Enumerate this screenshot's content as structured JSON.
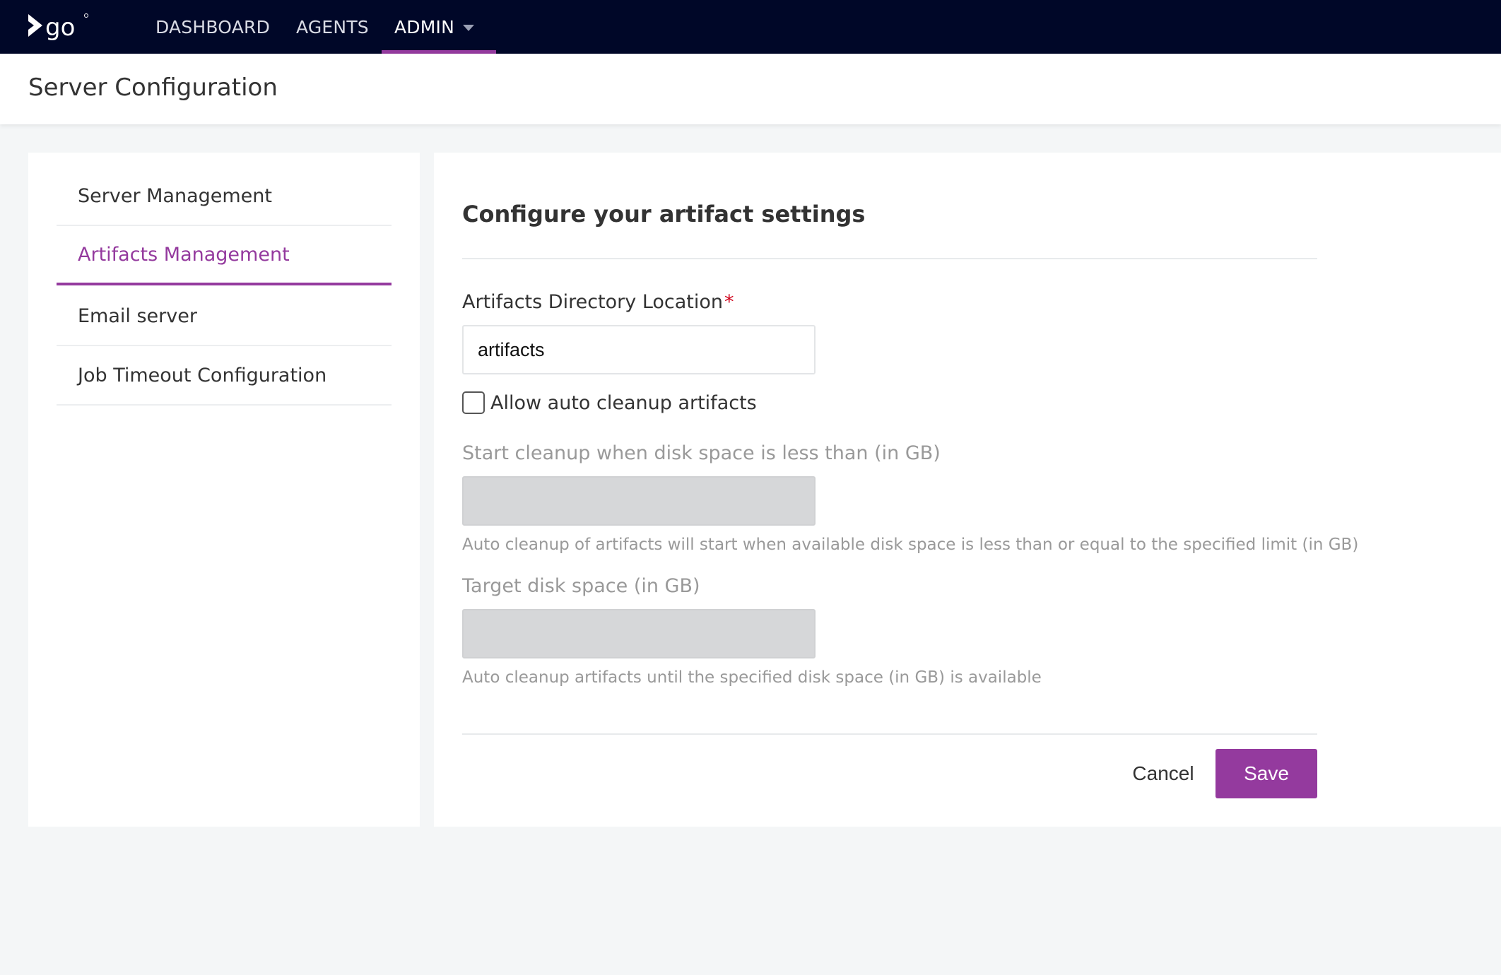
{
  "brand": {
    "logo_text": "go",
    "accent_color": "#943a9e",
    "nav_bg": "#000728"
  },
  "topnav": {
    "items": [
      {
        "label": "DASHBOARD"
      },
      {
        "label": "AGENTS"
      },
      {
        "label": "ADMIN",
        "active": true,
        "has_dropdown": true
      }
    ]
  },
  "page": {
    "title": "Server Configuration"
  },
  "sidebar": {
    "items": [
      {
        "label": "Server Management"
      },
      {
        "label": "Artifacts Management",
        "active": true
      },
      {
        "label": "Email server"
      },
      {
        "label": "Job Timeout Configuration"
      }
    ]
  },
  "form": {
    "title": "Configure your artifact settings",
    "artifacts_dir": {
      "label": "Artifacts Directory Location",
      "required_marker": "*",
      "value": "artifacts"
    },
    "auto_cleanup": {
      "label": "Allow auto cleanup artifacts",
      "checked": false
    },
    "start_cleanup": {
      "label": "Start cleanup when disk space is less than (in GB)",
      "value": "",
      "disabled": true,
      "help": "Auto cleanup of artifacts will start when available disk space is less than or equal to the specified limit (in GB)"
    },
    "target_disk": {
      "label": "Target disk space (in GB)",
      "value": "",
      "disabled": true,
      "help": "Auto cleanup artifacts until the specified disk space (in GB) is available"
    },
    "cancel_label": "Cancel",
    "save_label": "Save"
  }
}
